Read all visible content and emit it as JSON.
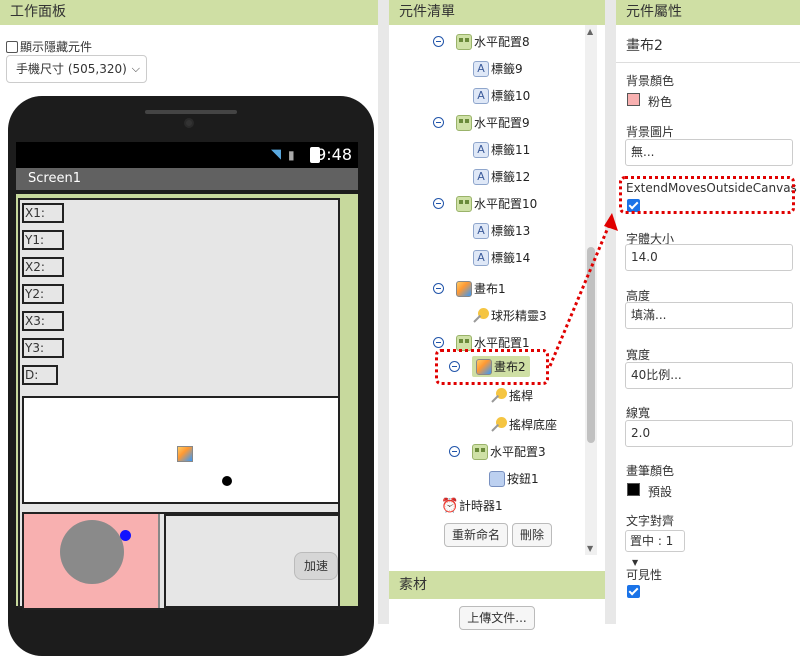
{
  "viewer": {
    "title": "工作面板",
    "show_hidden_label": "顯示隱藏元件",
    "size_select": "手機尺寸 (505,320)",
    "status_time": "9:48",
    "screen_title": "Screen1",
    "labels": [
      "X1:",
      "Y1:",
      "X2:",
      "Y2:",
      "X3:",
      "Y3:",
      "D:"
    ],
    "speed_button": "加速"
  },
  "components": {
    "title": "元件清單",
    "items": [
      {
        "label": "水平配置8",
        "icon": "arrangement-icon"
      },
      {
        "label": "標籤9",
        "icon": "label-icon"
      },
      {
        "label": "標籤10",
        "icon": "label-icon"
      },
      {
        "label": "水平配置9",
        "icon": "arrangement-icon"
      },
      {
        "label": "標籤11",
        "icon": "label-icon"
      },
      {
        "label": "標籤12",
        "icon": "label-icon"
      },
      {
        "label": "水平配置10",
        "icon": "arrangement-icon"
      },
      {
        "label": "標籤13",
        "icon": "label-icon"
      },
      {
        "label": "標籤14",
        "icon": "label-icon"
      },
      {
        "label": "畫布1",
        "icon": "canvas-icon"
      },
      {
        "label": "球形精靈3",
        "icon": "sprite-icon"
      },
      {
        "label": "水平配置1",
        "icon": "arrangement-icon"
      },
      {
        "label": "畫布2",
        "icon": "canvas-icon"
      },
      {
        "label": "搖桿",
        "icon": "sprite-icon"
      },
      {
        "label": "搖桿底座",
        "icon": "sprite-icon"
      },
      {
        "label": "水平配置3",
        "icon": "arrangement-icon"
      },
      {
        "label": "按鈕1",
        "icon": "button-icon"
      },
      {
        "label": "計時器1",
        "icon": "timer-icon"
      }
    ],
    "rename_button": "重新命名",
    "delete_button": "刪除",
    "media_title": "素材",
    "upload_button": "上傳文件..."
  },
  "properties": {
    "title": "元件屬性",
    "component_name": "畫布2",
    "bg_color_label": "背景顏色",
    "bg_color_value": "粉色",
    "bg_color_hex": "#f8b0b0",
    "bg_image_label": "背景圖片",
    "bg_image_value": "無...",
    "extend_label": "ExtendMovesOutsideCanvas",
    "font_size_label": "字體大小",
    "font_size_value": "14.0",
    "height_label": "高度",
    "height_value": "填滿...",
    "width_label": "寬度",
    "width_value": "40比例...",
    "line_width_label": "線寬",
    "line_width_value": "2.0",
    "paint_color_label": "畫筆顏色",
    "paint_color_value": "預設",
    "text_align_label": "文字對齊",
    "text_align_value": "置中 : 1",
    "visible_label": "可見性"
  }
}
